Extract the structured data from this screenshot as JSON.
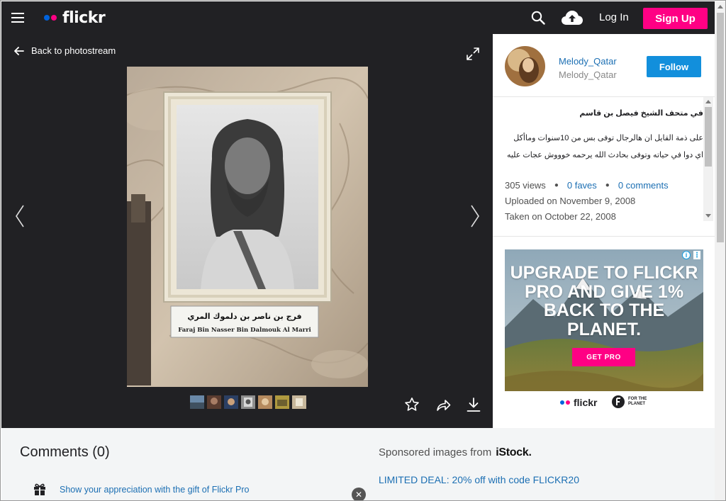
{
  "header": {
    "logo_text": "flickr",
    "login_label": "Log In",
    "signup_label": "Sign Up",
    "colors": {
      "brand_blue": "#0063dc",
      "brand_pink": "#ff0084"
    }
  },
  "viewer": {
    "back_label": "Back to photostream",
    "photo_caption_arabic": "فرج بن ناصر بن دلموك المري",
    "photo_caption_english": "Faraj Bin Nasser Bin Dalmouk Al Marri",
    "thumbnails_count": 7
  },
  "sidebar": {
    "username": "Melody_Qatar",
    "alias": "Melody_Qatar",
    "follow_label": "Follow",
    "photo_title": "في متحف الشيخ فيصل بن قاسم",
    "photo_description": "على ذمة القايل ان هالرجال توفى بس من 10سنوات وماأكل اي دوا في حياته وتوفى بحادث الله يرحمه خوووش عجات عليه",
    "views": "305 views",
    "faves": "0 faves",
    "comments": "0 comments",
    "uploaded": "Uploaded on November 9, 2008",
    "taken": "Taken on October 22, 2008"
  },
  "ad": {
    "headline": "UPGRADE TO FLICKR PRO AND GIVE 1% BACK TO THE PLANET.",
    "button": "GET PRO",
    "brand": "flickr",
    "partner_line1": "FOR THE",
    "partner_line2": "PLANET"
  },
  "bottom": {
    "comments_heading": "Comments (0)",
    "gift_link": "Show your appreciation with the gift of Flickr Pro",
    "sponsored_label": "Sponsored images from",
    "sponsored_brand": "iStock.",
    "deal_link": "LIMITED DEAL: 20% off with code FLICKR20"
  }
}
